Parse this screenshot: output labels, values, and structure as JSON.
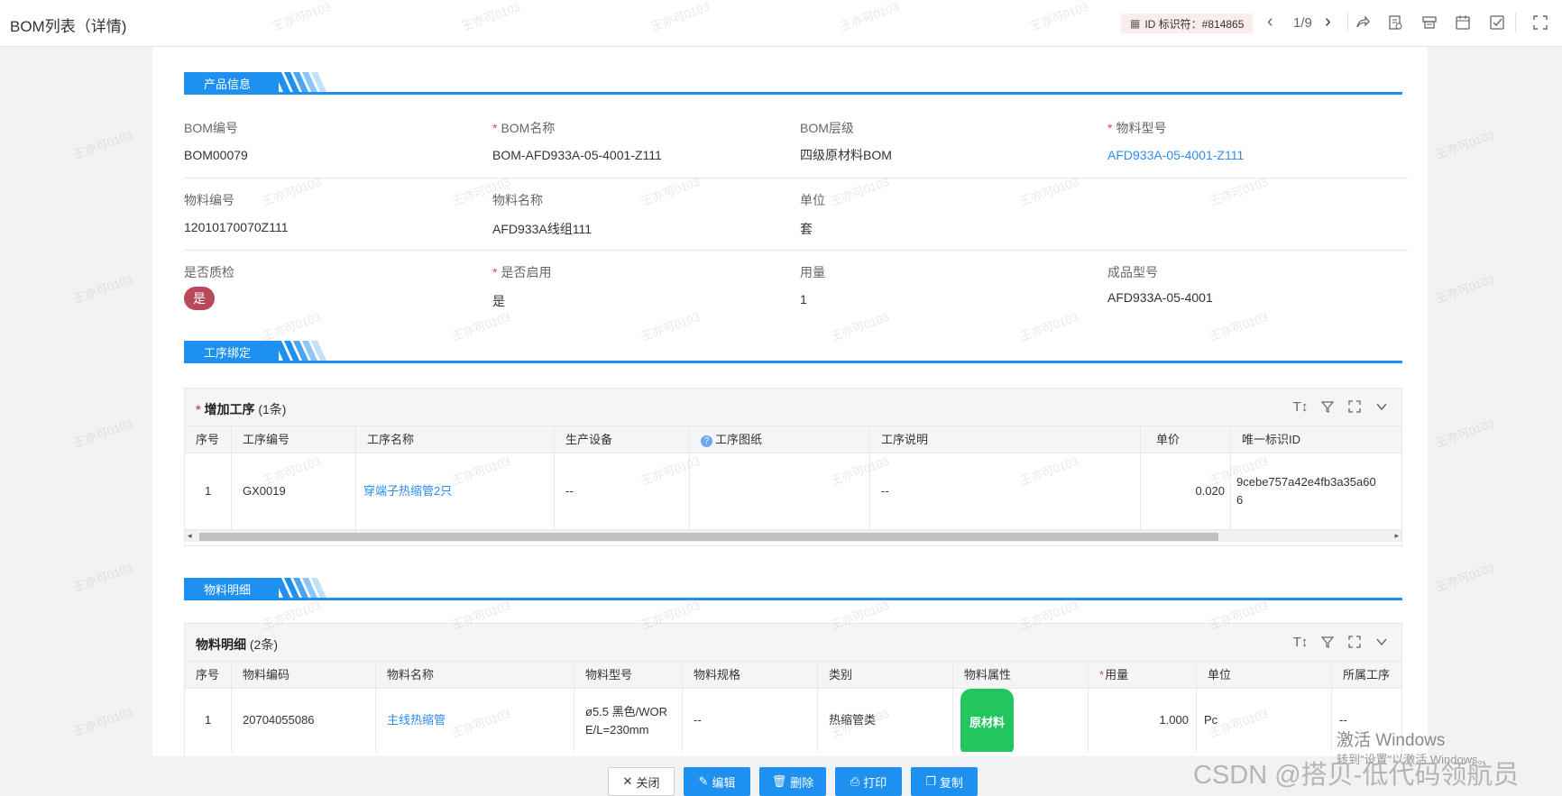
{
  "window": {
    "title": "BOM列表（详情)"
  },
  "toolbar": {
    "id_chip": "ID 标识符：#814865",
    "pager": "1/9",
    "icons": [
      "chevron-left-icon",
      "chevron-right-icon",
      "share-icon",
      "doc-icon",
      "print-icon",
      "calendar-icon",
      "check-icon",
      "fullscreen-icon"
    ]
  },
  "sections": {
    "product": "产品信息",
    "process": "工序绑定",
    "material": "物料明细"
  },
  "product": {
    "bom_no_label": "BOM编号",
    "bom_no": "BOM00079",
    "bom_name_label": "BOM名称",
    "bom_name": "BOM-AFD933A-05-4001-Z111",
    "bom_level_label": "BOM层级",
    "bom_level": "四级原材料BOM",
    "material_model_label": "物料型号",
    "material_model": "AFD933A-05-4001-Z111",
    "material_no_label": "物料编号",
    "material_no": "12010170070Z111",
    "material_name_label": "物料名称",
    "material_name": "AFD933A线组111",
    "unit_label": "单位",
    "unit": "套",
    "qc_label": "是否质检",
    "qc": "是",
    "enabled_label": "是否启用",
    "enabled": "是",
    "usage_label": "用量",
    "usage": "1",
    "product_model_label": "成品型号",
    "product_model": "AFD933A-05-4001"
  },
  "process_table": {
    "title": "增加工序",
    "count": "(1条)",
    "columns": [
      "序号",
      "工序编号",
      "工序名称",
      "生产设备",
      "工序图纸",
      "工序说明",
      "单价",
      "唯一标识ID"
    ],
    "rows": [
      {
        "no": "1",
        "code": "GX0019",
        "name": "穿端子热缩管2只",
        "equipment": "--",
        "drawing": "",
        "desc": "--",
        "price": "0.020",
        "uid_line1": "9cebe757a42e4fb3a35a60",
        "uid_line2": "6"
      }
    ]
  },
  "material_table": {
    "title": "物料明细",
    "count": "(2条)",
    "columns": [
      "序号",
      "物料编码",
      "物料名称",
      "物料型号",
      "物料规格",
      "类别",
      "物料属性",
      "用量",
      "单位",
      "所属工序"
    ],
    "rows": [
      {
        "no": "1",
        "code": "20704055086",
        "name": "主线热缩管",
        "model_line1": "ø5.5 黑色/WOR",
        "model_line2": "E/L=230mm",
        "spec": "--",
        "category": "热缩管类",
        "attr": "原材料",
        "usage": "1.000",
        "unit": "Pc",
        "process": "--"
      }
    ]
  },
  "footer": {
    "close": "关闭",
    "edit": "编辑",
    "delete": "删除",
    "print": "打印",
    "copy": "复制"
  },
  "watermark": "王亦可0103",
  "overlay": {
    "windows_activate": "激活 Windows",
    "windows_sub": "转到\"设置\"以激活 Windows。",
    "csdn": "CSDN @搭贝-低代码领航员"
  },
  "colors": {
    "accent": "#1e90f0",
    "badge_yes": "#b8485a",
    "attr_green": "#22c55e",
    "required": "#e04c4c"
  }
}
